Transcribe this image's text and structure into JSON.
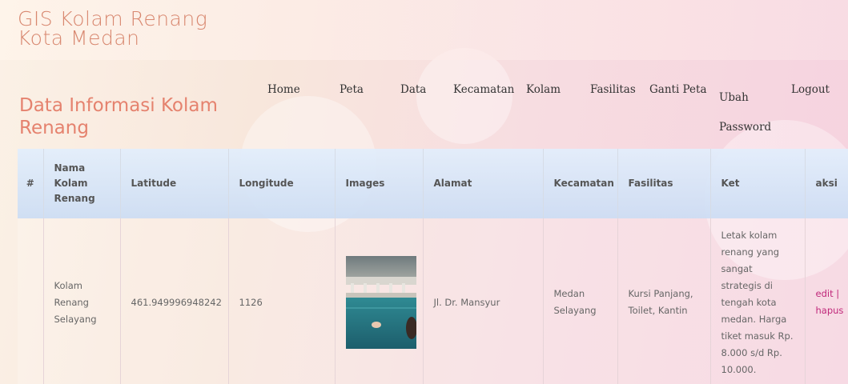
{
  "site_title": "GIS Kolam Renang Kota Medan",
  "page_heading": "Data Informasi Kolam Renang",
  "nav": [
    {
      "label": "Home"
    },
    {
      "label": "Peta"
    },
    {
      "label": "Data"
    },
    {
      "label": "Kecamatan"
    },
    {
      "label": "Kolam"
    },
    {
      "label": "Fasilitas"
    },
    {
      "label": "Ganti Peta"
    },
    {
      "label": "Ubah Password"
    },
    {
      "label": "Logout"
    }
  ],
  "table": {
    "headers": [
      "#",
      "Nama Kolam Renang",
      "Latitude",
      "Longitude",
      "Images",
      "Alamat",
      "Kecamatan",
      "Fasilitas",
      "Ket",
      "aksi"
    ],
    "rows": [
      {
        "index": "",
        "nama": "Kolam Renang Selayang",
        "latitude": "461.949996948242",
        "longitude": "1126",
        "alamat": "Jl. Dr. Mansyur",
        "kecamatan": "Medan Selayang",
        "fasilitas": "Kursi Panjang, Toilet, Kantin",
        "ket": "Letak kolam renang yang sangat strategis di tengah kota medan. Harga tiket masuk Rp. 8.000 s/d Rp. 10.000.",
        "edit_label": "edit",
        "separator": "|",
        "delete_label": "hapus"
      }
    ]
  },
  "colors": {
    "title": "#d8876f",
    "heading": "#e5826e",
    "action_link": "#c0287a"
  }
}
